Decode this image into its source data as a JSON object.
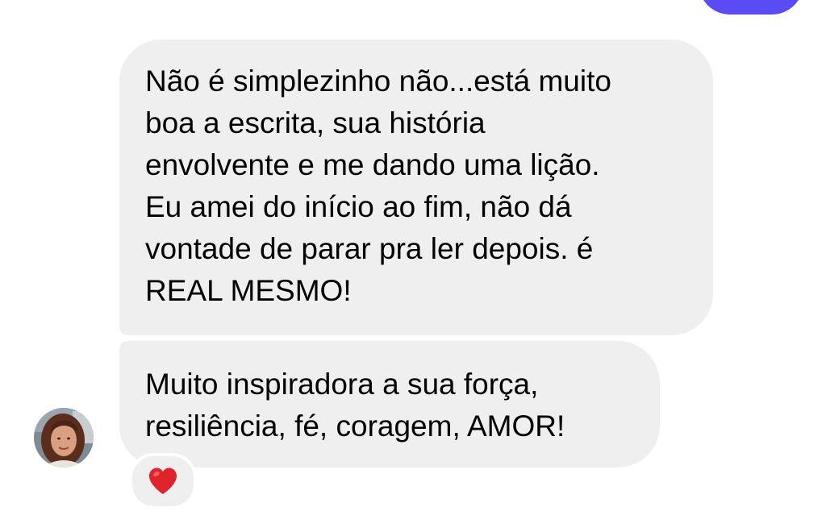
{
  "messages": [
    {
      "text": "Não é simplezinho não...está muito\nboa a escrita, sua história\nenvolvente e me dando uma lição.\nEu amei do início ao fim, não dá\nvontade de parar pra ler depois. é\nREAL MESMO!"
    },
    {
      "text": "Muito inspiradora a sua força,\nresiliência, fé,  coragem, AMOR!"
    }
  ],
  "reaction": {
    "icon": "heart-icon",
    "color": "#e0242e"
  },
  "colors": {
    "received_bubble": "#efeff0",
    "sent_bubble": "#5b4bf5",
    "background": "#ffffff"
  }
}
